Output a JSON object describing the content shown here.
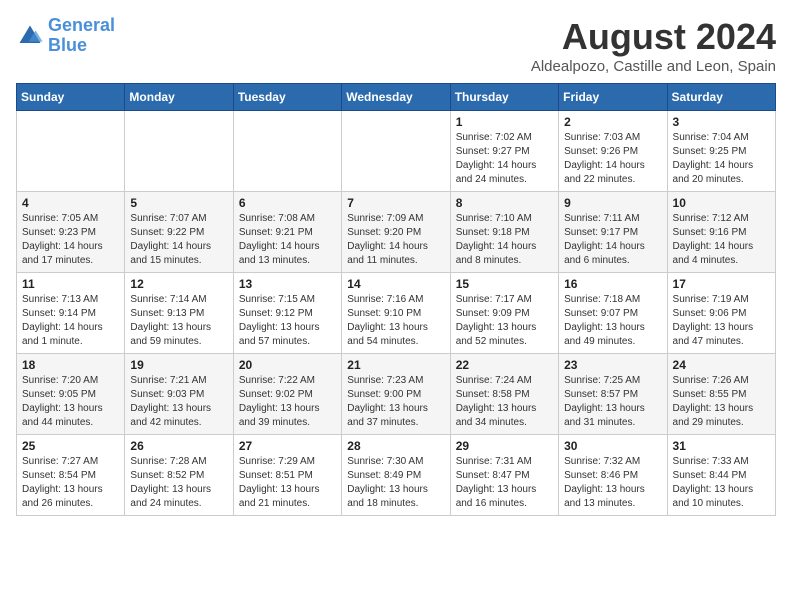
{
  "logo": {
    "line1": "General",
    "line2": "Blue"
  },
  "title": "August 2024",
  "location": "Aldealpozo, Castille and Leon, Spain",
  "weekdays": [
    "Sunday",
    "Monday",
    "Tuesday",
    "Wednesday",
    "Thursday",
    "Friday",
    "Saturday"
  ],
  "weeks": [
    [
      {
        "day": "",
        "info": ""
      },
      {
        "day": "",
        "info": ""
      },
      {
        "day": "",
        "info": ""
      },
      {
        "day": "",
        "info": ""
      },
      {
        "day": "1",
        "info": "Sunrise: 7:02 AM\nSunset: 9:27 PM\nDaylight: 14 hours\nand 24 minutes."
      },
      {
        "day": "2",
        "info": "Sunrise: 7:03 AM\nSunset: 9:26 PM\nDaylight: 14 hours\nand 22 minutes."
      },
      {
        "day": "3",
        "info": "Sunrise: 7:04 AM\nSunset: 9:25 PM\nDaylight: 14 hours\nand 20 minutes."
      }
    ],
    [
      {
        "day": "4",
        "info": "Sunrise: 7:05 AM\nSunset: 9:23 PM\nDaylight: 14 hours\nand 17 minutes."
      },
      {
        "day": "5",
        "info": "Sunrise: 7:07 AM\nSunset: 9:22 PM\nDaylight: 14 hours\nand 15 minutes."
      },
      {
        "day": "6",
        "info": "Sunrise: 7:08 AM\nSunset: 9:21 PM\nDaylight: 14 hours\nand 13 minutes."
      },
      {
        "day": "7",
        "info": "Sunrise: 7:09 AM\nSunset: 9:20 PM\nDaylight: 14 hours\nand 11 minutes."
      },
      {
        "day": "8",
        "info": "Sunrise: 7:10 AM\nSunset: 9:18 PM\nDaylight: 14 hours\nand 8 minutes."
      },
      {
        "day": "9",
        "info": "Sunrise: 7:11 AM\nSunset: 9:17 PM\nDaylight: 14 hours\nand 6 minutes."
      },
      {
        "day": "10",
        "info": "Sunrise: 7:12 AM\nSunset: 9:16 PM\nDaylight: 14 hours\nand 4 minutes."
      }
    ],
    [
      {
        "day": "11",
        "info": "Sunrise: 7:13 AM\nSunset: 9:14 PM\nDaylight: 14 hours\nand 1 minute."
      },
      {
        "day": "12",
        "info": "Sunrise: 7:14 AM\nSunset: 9:13 PM\nDaylight: 13 hours\nand 59 minutes."
      },
      {
        "day": "13",
        "info": "Sunrise: 7:15 AM\nSunset: 9:12 PM\nDaylight: 13 hours\nand 57 minutes."
      },
      {
        "day": "14",
        "info": "Sunrise: 7:16 AM\nSunset: 9:10 PM\nDaylight: 13 hours\nand 54 minutes."
      },
      {
        "day": "15",
        "info": "Sunrise: 7:17 AM\nSunset: 9:09 PM\nDaylight: 13 hours\nand 52 minutes."
      },
      {
        "day": "16",
        "info": "Sunrise: 7:18 AM\nSunset: 9:07 PM\nDaylight: 13 hours\nand 49 minutes."
      },
      {
        "day": "17",
        "info": "Sunrise: 7:19 AM\nSunset: 9:06 PM\nDaylight: 13 hours\nand 47 minutes."
      }
    ],
    [
      {
        "day": "18",
        "info": "Sunrise: 7:20 AM\nSunset: 9:05 PM\nDaylight: 13 hours\nand 44 minutes."
      },
      {
        "day": "19",
        "info": "Sunrise: 7:21 AM\nSunset: 9:03 PM\nDaylight: 13 hours\nand 42 minutes."
      },
      {
        "day": "20",
        "info": "Sunrise: 7:22 AM\nSunset: 9:02 PM\nDaylight: 13 hours\nand 39 minutes."
      },
      {
        "day": "21",
        "info": "Sunrise: 7:23 AM\nSunset: 9:00 PM\nDaylight: 13 hours\nand 37 minutes."
      },
      {
        "day": "22",
        "info": "Sunrise: 7:24 AM\nSunset: 8:58 PM\nDaylight: 13 hours\nand 34 minutes."
      },
      {
        "day": "23",
        "info": "Sunrise: 7:25 AM\nSunset: 8:57 PM\nDaylight: 13 hours\nand 31 minutes."
      },
      {
        "day": "24",
        "info": "Sunrise: 7:26 AM\nSunset: 8:55 PM\nDaylight: 13 hours\nand 29 minutes."
      }
    ],
    [
      {
        "day": "25",
        "info": "Sunrise: 7:27 AM\nSunset: 8:54 PM\nDaylight: 13 hours\nand 26 minutes."
      },
      {
        "day": "26",
        "info": "Sunrise: 7:28 AM\nSunset: 8:52 PM\nDaylight: 13 hours\nand 24 minutes."
      },
      {
        "day": "27",
        "info": "Sunrise: 7:29 AM\nSunset: 8:51 PM\nDaylight: 13 hours\nand 21 minutes."
      },
      {
        "day": "28",
        "info": "Sunrise: 7:30 AM\nSunset: 8:49 PM\nDaylight: 13 hours\nand 18 minutes."
      },
      {
        "day": "29",
        "info": "Sunrise: 7:31 AM\nSunset: 8:47 PM\nDaylight: 13 hours\nand 16 minutes."
      },
      {
        "day": "30",
        "info": "Sunrise: 7:32 AM\nSunset: 8:46 PM\nDaylight: 13 hours\nand 13 minutes."
      },
      {
        "day": "31",
        "info": "Sunrise: 7:33 AM\nSunset: 8:44 PM\nDaylight: 13 hours\nand 10 minutes."
      }
    ]
  ]
}
